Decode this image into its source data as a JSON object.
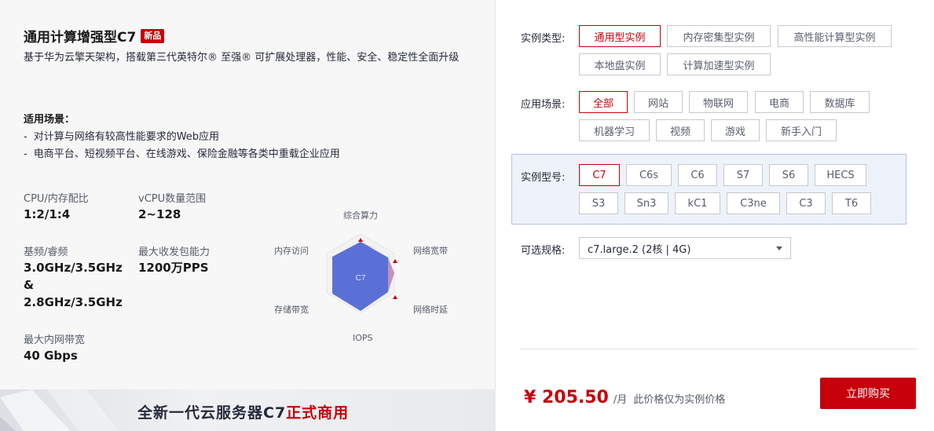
{
  "product": {
    "title": "通用计算增强型C7",
    "badge": "新品",
    "description": "基于华为云擎天架构，搭载第三代英特尔® 至强® 可扩展处理器，性能、安全、稳定性全面升级",
    "scenarios_title": "适用场景：",
    "scenarios": [
      "对计算与网络有较高性能要求的Web应用",
      "电商平台、短视频平台、在线游戏、保险金融等各类中重载企业应用"
    ],
    "specs": {
      "cpu_mem_label": "CPU/内存配比",
      "cpu_mem_value": "1:2/1:4",
      "vcpu_label": "vCPU数量范围",
      "vcpu_value": "2~128",
      "freq_label": "基频/睿频",
      "freq_value_1": "3.0GHz/3.5GHz",
      "freq_value_amp": "&",
      "freq_value_2": "2.8GHz/3.5GHz",
      "pps_label": "最大收发包能力",
      "pps_value": "1200万PPS",
      "bw_label": "最大内网带宽",
      "bw_value": "40 Gbps"
    },
    "radar": {
      "center": "C7",
      "axes": [
        "综合算力",
        "网络宽带",
        "网络时延",
        "IOPS",
        "存储带宽",
        "内存访问"
      ]
    },
    "banner": {
      "text_main": "全新一代云服务器C7",
      "text_highlight": "正式商用"
    }
  },
  "filters": {
    "type_label": "实例类型:",
    "types": [
      "通用型实例",
      "内存密集型实例",
      "高性能计算型实例",
      "本地盘实例",
      "计算加速型实例"
    ],
    "scene_label": "应用场景:",
    "scenes": [
      "全部",
      "网站",
      "物联网",
      "电商",
      "数据库",
      "机器学习",
      "视频",
      "游戏",
      "新手入门"
    ],
    "model_label": "实例型号:",
    "models": [
      "C7",
      "C6s",
      "C6",
      "S7",
      "S6",
      "HECS",
      "S3",
      "Sn3",
      "kC1",
      "C3ne",
      "C3",
      "T6"
    ],
    "spec_label": "可选规格:",
    "spec_value": "c7.large.2 (2核 | 4G)"
  },
  "purchase": {
    "price": "¥ 205.50",
    "unit": "/月",
    "note": "此价格仅为实例价格",
    "buy_label": "立即购买"
  },
  "colors": {
    "accent": "#c7000b",
    "radar_fill": "#5b70d6"
  }
}
